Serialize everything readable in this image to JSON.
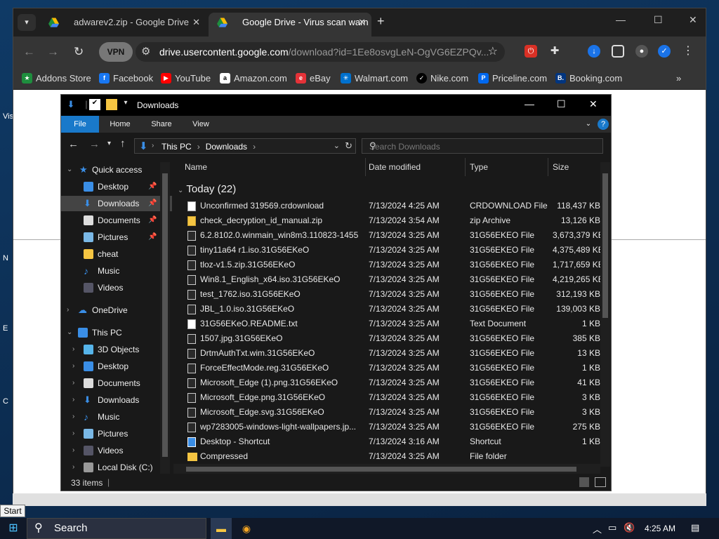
{
  "desktop": {
    "labels": [
      "Vis",
      "N",
      "E",
      "C",
      "C\nV"
    ]
  },
  "browser": {
    "tabs": [
      {
        "title": "adwarev2.zip - Google Drive",
        "active": false
      },
      {
        "title": "Google Drive - Virus scan warn",
        "active": true
      }
    ],
    "new_tab_symbol": "+",
    "window_controls": {
      "minimize": "—",
      "maximize": "☐",
      "close": "✕"
    },
    "vpn_label": "VPN",
    "url_host": "drive.usercontent.google.com",
    "url_rest": "/download?id=1Ee8osvgLeN-OgVG6EZPQv...",
    "bookmarks": [
      "Addons Store",
      "Facebook",
      "YouTube",
      "Amazon.com",
      "eBay",
      "Walmart.com",
      "Nike.com",
      "Priceline.com",
      "Booking.com"
    ],
    "bookmarks_more": "»"
  },
  "explorer": {
    "title": "Downloads",
    "ribbon_tabs": [
      "File",
      "Home",
      "Share",
      "View"
    ],
    "path": [
      "This PC",
      "Downloads"
    ],
    "search_placeholder": "Search Downloads",
    "nav": {
      "quick_access": "Quick access",
      "quick_items": [
        "Desktop",
        "Downloads",
        "Documents",
        "Pictures",
        "cheat",
        "Music",
        "Videos"
      ],
      "onedrive": "OneDrive",
      "this_pc": "This PC",
      "pc_items": [
        "3D Objects",
        "Desktop",
        "Documents",
        "Downloads",
        "Music",
        "Pictures",
        "Videos",
        "Local Disk (C:)"
      ]
    },
    "columns": [
      "Name",
      "Date modified",
      "Type",
      "Size"
    ],
    "group_label": "Today (22)",
    "files": [
      {
        "name": "Unconfirmed 319569.crdownload",
        "date": "7/13/2024 4:25 AM",
        "type": "CRDOWNLOAD File",
        "size": "118,437 KB",
        "icon": "doc"
      },
      {
        "name": "check_decryption_id_manual.zip",
        "date": "7/13/2024 3:54 AM",
        "type": "zip Archive",
        "size": "13,126 KB",
        "icon": "zip"
      },
      {
        "name": "6.2.8102.0.winmain_win8m3.110823-1455...",
        "date": "7/13/2024 3:25 AM",
        "type": "31G56EKEO File",
        "size": "3,673,379 KB",
        "icon": "locked"
      },
      {
        "name": "tiny11a64 r1.iso.31G56EKeO",
        "date": "7/13/2024 3:25 AM",
        "type": "31G56EKEO File",
        "size": "4,375,489 KB",
        "icon": "locked"
      },
      {
        "name": "tloz-v1.5.zip.31G56EKeO",
        "date": "7/13/2024 3:25 AM",
        "type": "31G56EKEO File",
        "size": "1,717,659 KB",
        "icon": "locked"
      },
      {
        "name": "Win8.1_English_x64.iso.31G56EKeO",
        "date": "7/13/2024 3:25 AM",
        "type": "31G56EKEO File",
        "size": "4,219,265 KB",
        "icon": "locked"
      },
      {
        "name": "test_1762.iso.31G56EKeO",
        "date": "7/13/2024 3:25 AM",
        "type": "31G56EKEO File",
        "size": "312,193 KB",
        "icon": "locked"
      },
      {
        "name": "JBL_1.0.iso.31G56EKeO",
        "date": "7/13/2024 3:25 AM",
        "type": "31G56EKEO File",
        "size": "139,003 KB",
        "icon": "locked"
      },
      {
        "name": "31G56EKeO.README.txt",
        "date": "7/13/2024 3:25 AM",
        "type": "Text Document",
        "size": "1 KB",
        "icon": "txt"
      },
      {
        "name": "1507.jpg.31G56EKeO",
        "date": "7/13/2024 3:25 AM",
        "type": "31G56EKEO File",
        "size": "385 KB",
        "icon": "locked"
      },
      {
        "name": "DrtmAuthTxt.wim.31G56EKeO",
        "date": "7/13/2024 3:25 AM",
        "type": "31G56EKEO File",
        "size": "13 KB",
        "icon": "locked"
      },
      {
        "name": "ForceEffectMode.reg.31G56EKeO",
        "date": "7/13/2024 3:25 AM",
        "type": "31G56EKEO File",
        "size": "1 KB",
        "icon": "locked"
      },
      {
        "name": "Microsoft_Edge (1).png.31G56EKeO",
        "date": "7/13/2024 3:25 AM",
        "type": "31G56EKEO File",
        "size": "41 KB",
        "icon": "locked"
      },
      {
        "name": "Microsoft_Edge.png.31G56EKeO",
        "date": "7/13/2024 3:25 AM",
        "type": "31G56EKEO File",
        "size": "3 KB",
        "icon": "locked"
      },
      {
        "name": "Microsoft_Edge.svg.31G56EKeO",
        "date": "7/13/2024 3:25 AM",
        "type": "31G56EKEO File",
        "size": "3 KB",
        "icon": "locked"
      },
      {
        "name": "wp7283005-windows-light-wallpapers.jp...",
        "date": "7/13/2024 3:25 AM",
        "type": "31G56EKEO File",
        "size": "275 KB",
        "icon": "locked"
      },
      {
        "name": "Desktop - Shortcut",
        "date": "7/13/2024 3:16 AM",
        "type": "Shortcut",
        "size": "1 KB",
        "icon": "shortcut"
      },
      {
        "name": "Compressed",
        "date": "7/13/2024 3:25 AM",
        "type": "File folder",
        "size": "",
        "icon": "folder"
      }
    ],
    "status": "33 items"
  },
  "taskbar": {
    "start_tooltip": "Start",
    "search_label": "Search",
    "time": "4:25 AM"
  }
}
